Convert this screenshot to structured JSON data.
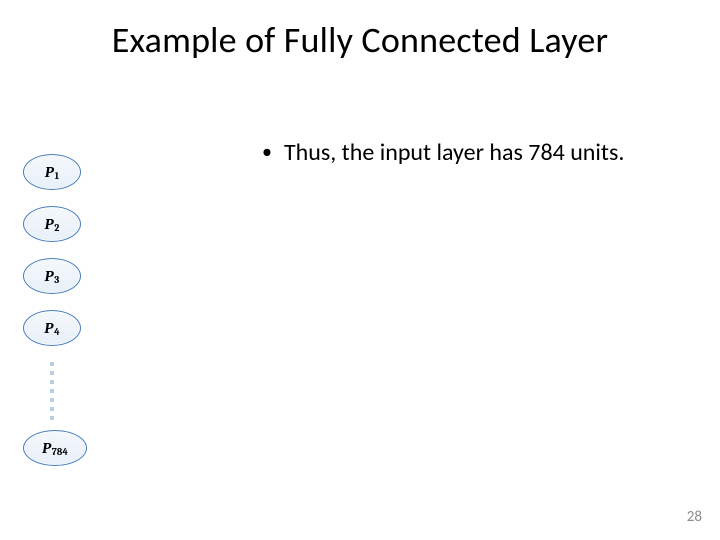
{
  "title": "Example of Fully Connected Layer",
  "bullet": {
    "marker": "•",
    "text": "Thus, the input layer has 784 units."
  },
  "nodes": {
    "var": "P",
    "subs": [
      "1",
      "2",
      "3",
      "4"
    ],
    "last_sub": "784"
  },
  "page_number": "28"
}
